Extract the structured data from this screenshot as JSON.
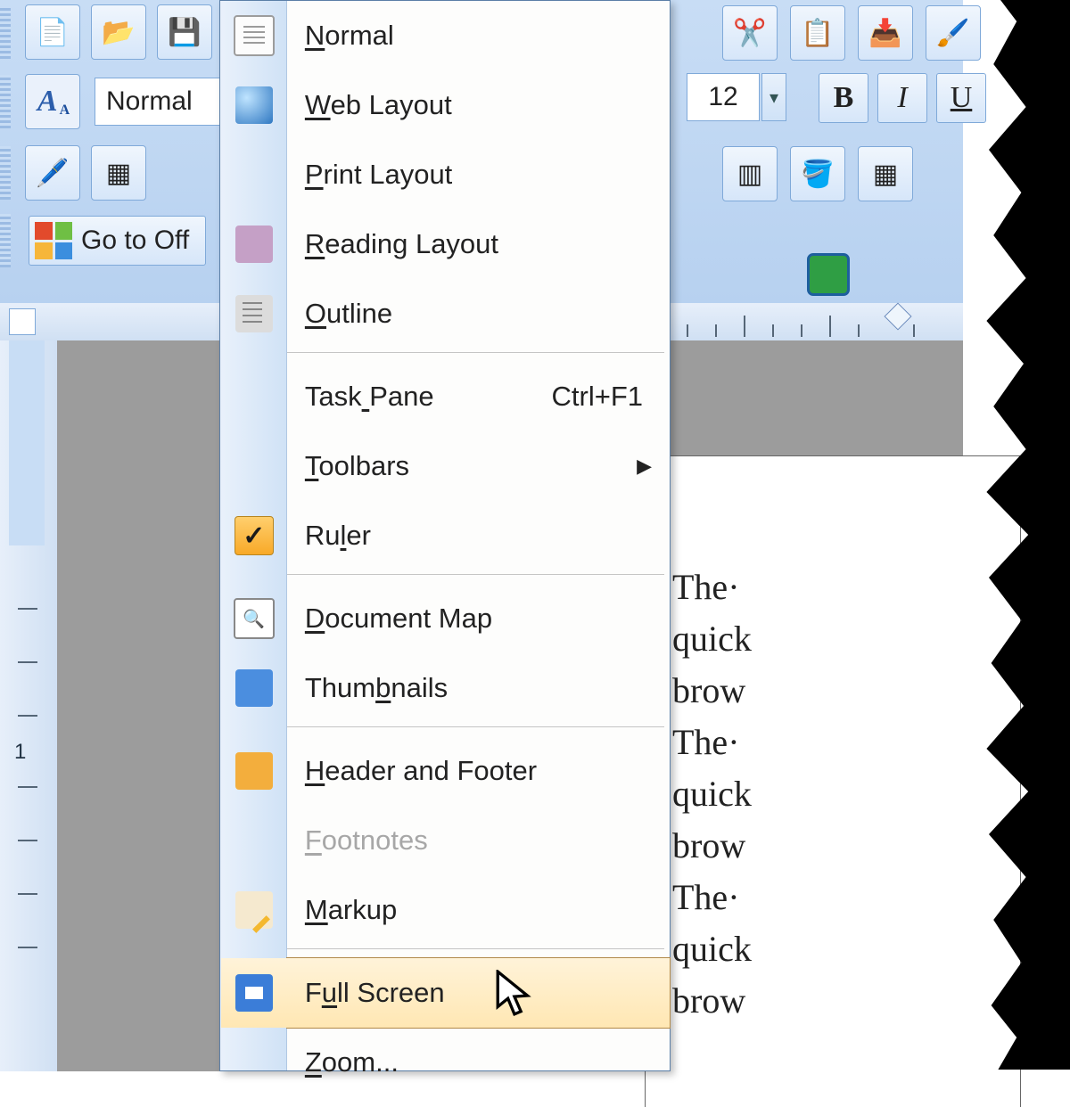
{
  "toolbar": {
    "style_name": "Normal",
    "font_size": "12",
    "bold": "B",
    "italic": "I",
    "underline": "U",
    "go_to_office": "Go to Off"
  },
  "font_icon_text": "A",
  "view_menu": {
    "items": [
      {
        "key": "normal",
        "label": "Normal",
        "u": 0,
        "icon": "doc"
      },
      {
        "key": "web",
        "label": "Web Layout",
        "u": 0,
        "icon": "globe"
      },
      {
        "key": "print",
        "label": "Print Layout",
        "u": 0,
        "icon": "page",
        "selected": true
      },
      {
        "key": "reading",
        "label": "Reading Layout",
        "u": 0,
        "icon": "book"
      },
      {
        "key": "outline",
        "label": "Outline",
        "u": 0,
        "icon": "outline"
      },
      {
        "sep": true
      },
      {
        "key": "taskpane",
        "label": "Task Pane",
        "u": 4,
        "shortcut": "Ctrl+F1"
      },
      {
        "key": "toolbars",
        "label": "Toolbars",
        "u": 0,
        "submenu": true
      },
      {
        "key": "ruler",
        "label": "Ruler",
        "u": 2,
        "icon": "check"
      },
      {
        "sep": true
      },
      {
        "key": "docmap",
        "label": "Document Map",
        "u": 0,
        "icon": "mag"
      },
      {
        "key": "thumbnails",
        "label": "Thumbnails",
        "u": 4,
        "icon": "thumb"
      },
      {
        "sep": true
      },
      {
        "key": "headerfooter",
        "label": "Header and Footer",
        "u": 0,
        "icon": "hf"
      },
      {
        "key": "footnotes",
        "label": "Footnotes",
        "u": 0,
        "disabled": true
      },
      {
        "key": "markup",
        "label": "Markup",
        "u": 0,
        "icon": "markup"
      },
      {
        "sep": true
      },
      {
        "key": "fullscreen",
        "label": "Full Screen",
        "u": 1,
        "icon": "full",
        "hover": true
      },
      {
        "key": "zoom",
        "label": "Zoom...",
        "u": 0
      }
    ]
  },
  "ruler": {
    "label_one": "1"
  },
  "document": {
    "lines": [
      "The·",
      "quick",
      "brow",
      "The·",
      "quick",
      "brow",
      "The·",
      "quick",
      "brow"
    ]
  }
}
